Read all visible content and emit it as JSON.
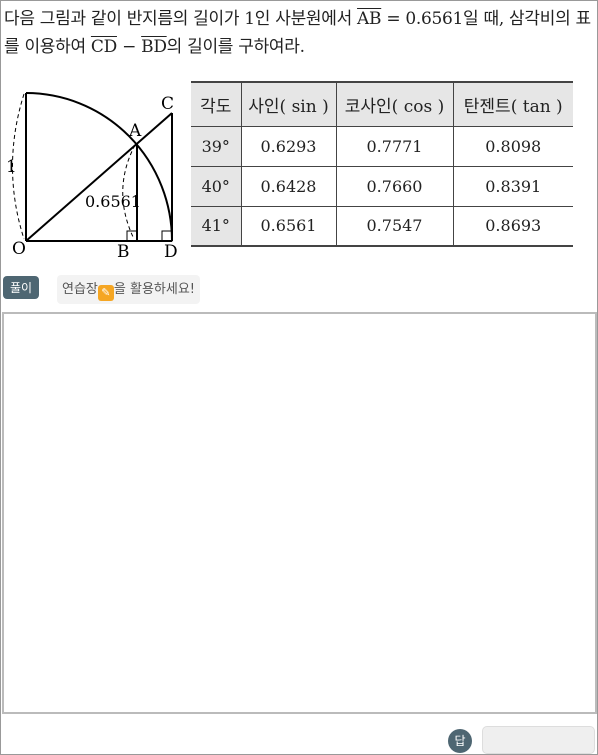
{
  "question": {
    "part1": "다음 그림과 같이 반지름의 길이가 1인 사분원에서 ",
    "ab": "AB",
    "part2": " = 0.6561일 때, 삼각비의 표를 이용하여 ",
    "cd": "CD",
    "minus": " − ",
    "bd": "BD",
    "part3": "의 길이를 구하여라."
  },
  "figure": {
    "labels": {
      "O": "O",
      "A": "A",
      "B": "B",
      "C": "C",
      "D": "D",
      "radius": "1",
      "ab_len": "0.6561"
    }
  },
  "table": {
    "headers": [
      "각도",
      "사인( sin )",
      "코사인( cos )",
      "탄젠트( tan )"
    ],
    "rows": [
      [
        "39°",
        "0.6293",
        "0.7771",
        "0.8098"
      ],
      [
        "40°",
        "0.6428",
        "0.7660",
        "0.8391"
      ],
      [
        "41°",
        "0.6561",
        "0.7547",
        "0.8693"
      ]
    ]
  },
  "solution_button": "풀이",
  "hint": {
    "before": "연습장",
    "after": "을 활용하세요!"
  },
  "answer_label": "답"
}
